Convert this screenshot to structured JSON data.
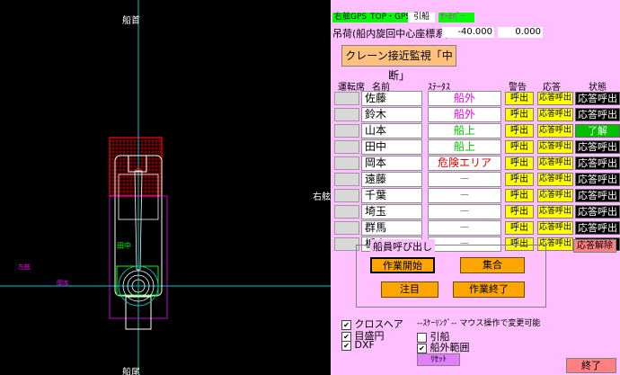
{
  "left_view": {
    "top_label": "船首",
    "bottom_label": "船尾",
    "right_label": "右舷",
    "left_label": "左舷",
    "center_label": "田中",
    "lower_small_label": "岡本",
    "left_small_label": "岡本",
    "colors": {
      "crosshair": "#00c8c8",
      "hull": "#ffffff",
      "danger": "#ff0000",
      "green": "#00ff00",
      "magenta": "#ff00ff"
    }
  },
  "toolbar": {
    "items": [
      "右舷GPS",
      "TOP・GPS",
      "引船",
      "ｻｰﾁﾊﾞｰ"
    ],
    "load_label": "吊荷(船内旋回中心座標系)",
    "x_value": "-40.000",
    "y_value": "0.000"
  },
  "crane_button": "クレーン接近監視「中断」",
  "table": {
    "headers": {
      "seat": "運転席",
      "name": "名前",
      "status": "ｽﾃｰﾀｽ",
      "alert": "警告",
      "response": "応答",
      "state": "状態"
    },
    "rows": [
      {
        "name": "佐藤",
        "status": "船外",
        "status_color": "#e000e0",
        "alert": "呼出",
        "response": "応答呼出",
        "state": "応答呼出",
        "state_color": "#000000"
      },
      {
        "name": "鈴木",
        "status": "船外",
        "status_color": "#e000e0",
        "alert": "呼出",
        "response": "応答呼出",
        "state": "応答呼出",
        "state_color": "#000000"
      },
      {
        "name": "山本",
        "status": "船上",
        "status_color": "#00c000",
        "alert": "呼出",
        "response": "応答呼出",
        "state": "了解",
        "state_color": "#00c000"
      },
      {
        "name": "田中",
        "status": "船上",
        "status_color": "#00c000",
        "alert": "呼出",
        "response": "応答呼出",
        "state": "応答呼出",
        "state_color": "#000000"
      },
      {
        "name": "岡本",
        "status": "危険エリア",
        "status_color": "#e00000",
        "alert": "呼出",
        "response": "応答呼出",
        "state": "応答呼出",
        "state_color": "#000000"
      },
      {
        "name": "遠藤",
        "status": "－",
        "status_color": "#808080",
        "alert": "呼出",
        "response": "応答呼出",
        "state": "応答呼出",
        "state_color": "#000000"
      },
      {
        "name": "千葉",
        "status": "－",
        "status_color": "#808080",
        "alert": "呼出",
        "response": "応答呼出",
        "state": "応答呼出",
        "state_color": "#000000"
      },
      {
        "name": "埼玉",
        "status": "－",
        "status_color": "#808080",
        "alert": "呼出",
        "response": "応答呼出",
        "state": "応答呼出",
        "state_color": "#000000"
      },
      {
        "name": "群馬",
        "status": "－",
        "status_color": "#808080",
        "alert": "呼出",
        "response": "応答呼出",
        "state": "応答呼出",
        "state_color": "#000000"
      },
      {
        "name": "栃木",
        "status": "－",
        "status_color": "#808080",
        "alert": "呼出",
        "response": "応答呼出",
        "state": "応答呼出",
        "state_color": "#000000"
      }
    ]
  },
  "response_release": "応答解除",
  "crew_call": {
    "title": "船員呼び出し",
    "buttons": [
      "作業開始",
      "集合",
      "注目",
      "作業終了"
    ]
  },
  "options": {
    "crosshair": "クロスヘア",
    "scale_circle": "目盛円",
    "dxf": "DXF",
    "scaling_title": "--ｽｹｰﾘﾝｸﾞ-- マウス操作で変更可能",
    "tow": "引船",
    "outboard_range": "船外範囲",
    "reset": "ﾘｾｯﾄ"
  },
  "exit_button": "終了"
}
